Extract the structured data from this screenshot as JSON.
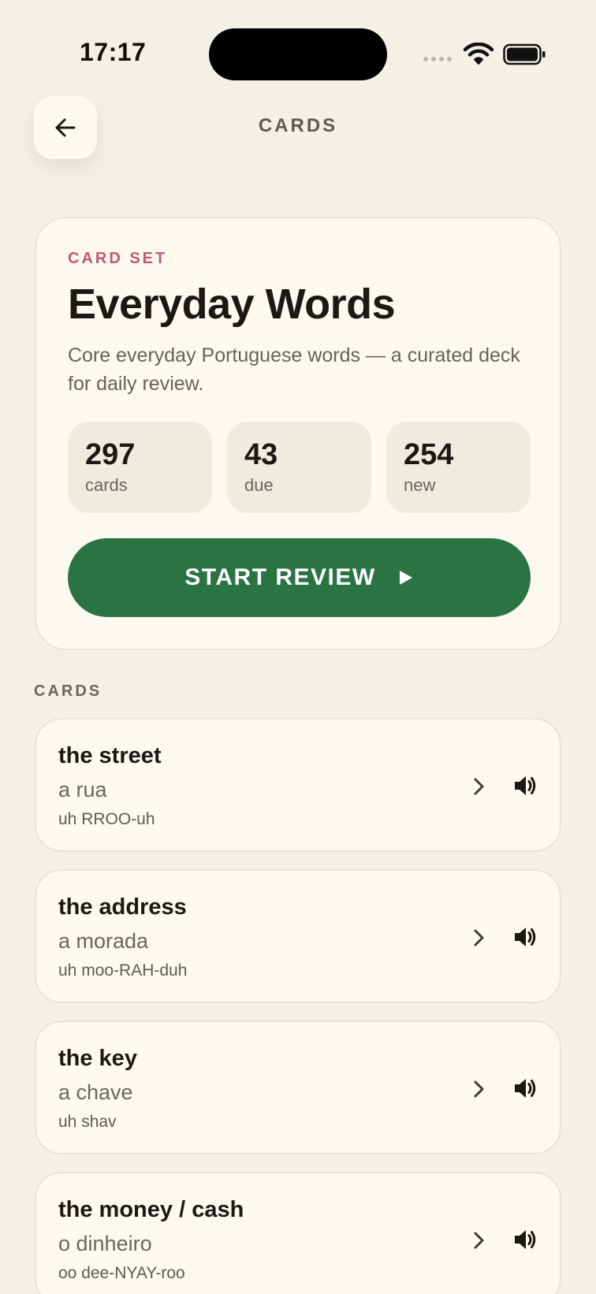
{
  "status_bar": {
    "time": "17:17"
  },
  "header": {
    "back_icon": "arrow-left-icon",
    "title": "CARDS"
  },
  "card_set": {
    "eyebrow": "CARD SET",
    "title": "Everyday Words",
    "description": "Core everyday Portuguese words — a curated deck for daily review.",
    "stats": [
      {
        "value": "297",
        "label": "cards"
      },
      {
        "value": "43",
        "label": "due"
      },
      {
        "value": "254",
        "label": "new"
      }
    ],
    "start_label": "START REVIEW",
    "start_icon": "play-icon"
  },
  "cards_section": {
    "label": "CARDS",
    "items": [
      {
        "english": "the street",
        "portuguese": "a rua",
        "pronunciation": "uh RROO-uh"
      },
      {
        "english": "the address",
        "portuguese": "a morada",
        "pronunciation": "uh moo-RAH-duh"
      },
      {
        "english": "the key",
        "portuguese": "a chave",
        "pronunciation": "uh shav"
      },
      {
        "english": "the money / cash",
        "portuguese": "o dinheiro",
        "pronunciation": "oo dee-NYAY-roo"
      }
    ]
  },
  "colors": {
    "background": "#f3f0e6",
    "card": "#fcf9ee",
    "accent_pink": "#c4577a",
    "primary_green": "#2a7343"
  }
}
